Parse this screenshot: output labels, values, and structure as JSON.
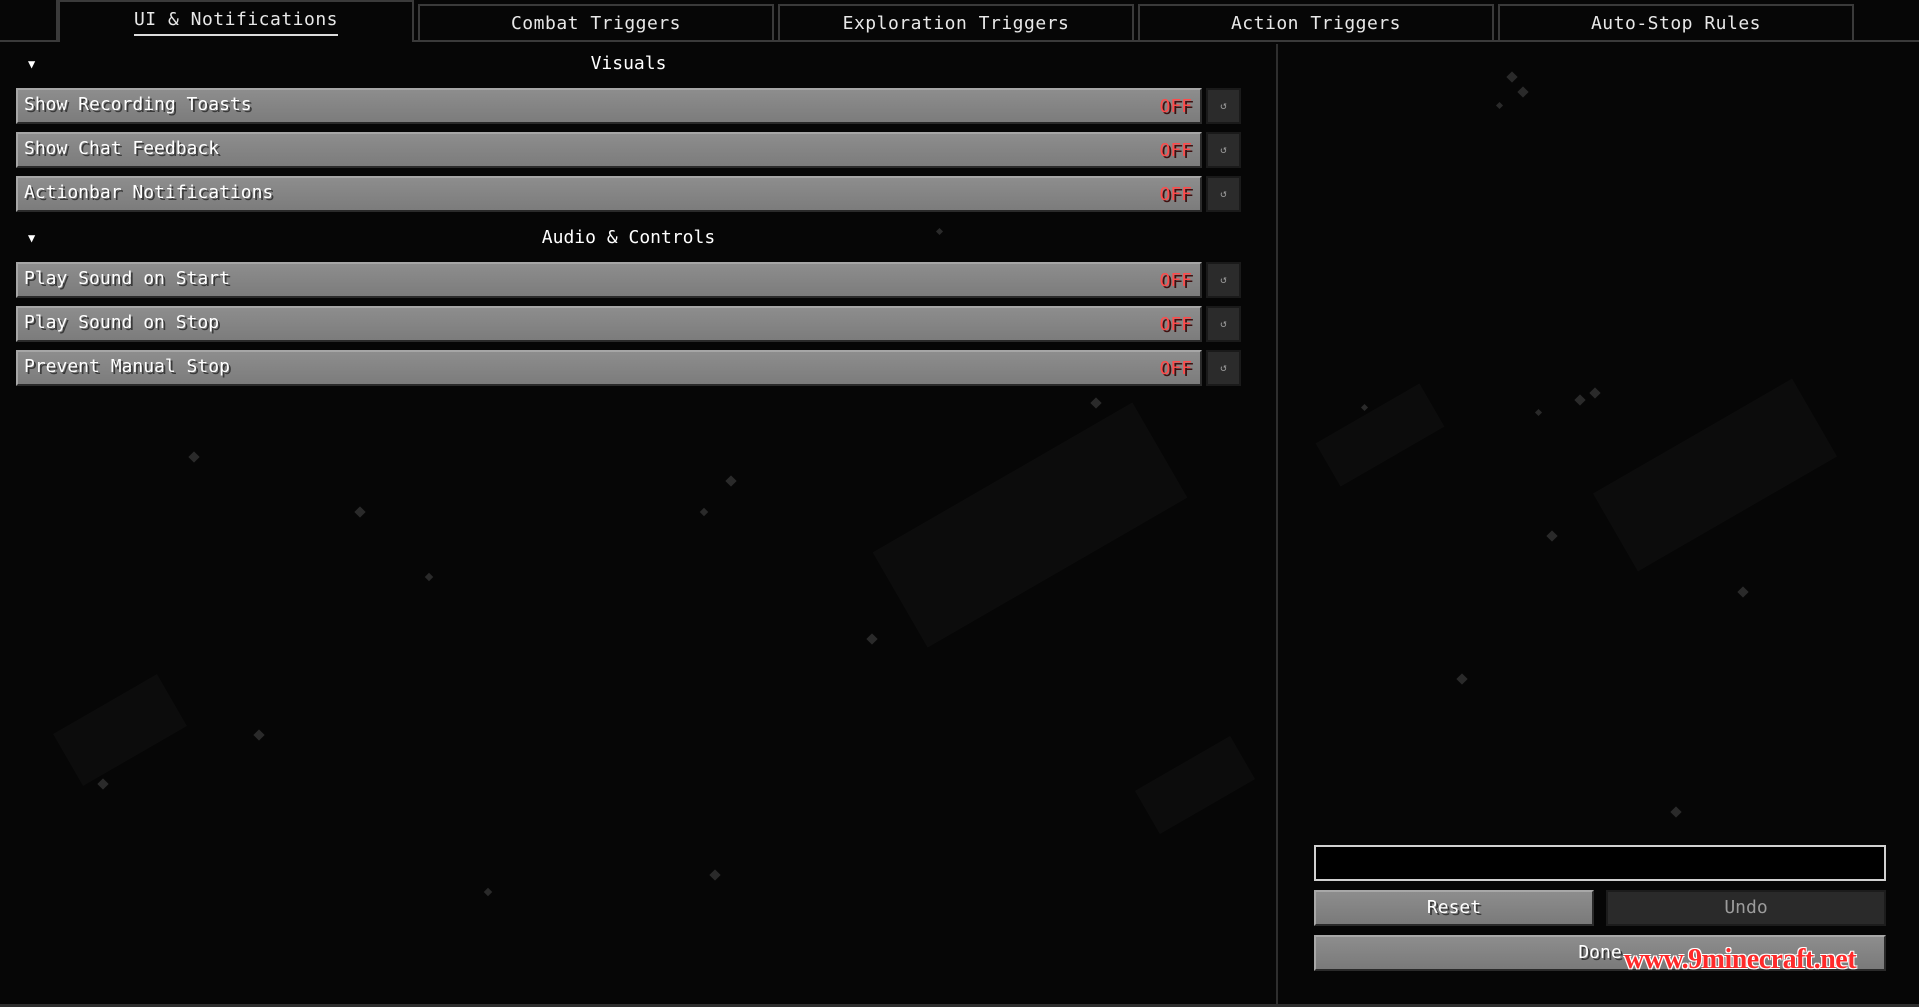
{
  "tabs": [
    {
      "label": "UI & Notifications",
      "active": true
    },
    {
      "label": "Combat Triggers",
      "active": false
    },
    {
      "label": "Exploration Triggers",
      "active": false
    },
    {
      "label": "Action Triggers",
      "active": false
    },
    {
      "label": "Auto-Stop Rules",
      "active": false
    }
  ],
  "sections": [
    {
      "title": "Visuals",
      "caret": "▼",
      "items": [
        {
          "label": "Show Recording Toasts",
          "value": "OFF",
          "reset": "↺"
        },
        {
          "label": "Show Chat Feedback",
          "value": "OFF",
          "reset": "↺"
        },
        {
          "label": "Actionbar Notifications",
          "value": "OFF",
          "reset": "↺"
        }
      ]
    },
    {
      "title": "Audio & Controls",
      "caret": "▼",
      "items": [
        {
          "label": "Play Sound on Start",
          "value": "OFF",
          "reset": "↺"
        },
        {
          "label": "Play Sound on Stop",
          "value": "OFF",
          "reset": "↺"
        },
        {
          "label": "Prevent Manual Stop",
          "value": "OFF",
          "reset": "↺"
        }
      ]
    }
  ],
  "side": {
    "search_value": "",
    "reset_label": "Reset",
    "undo_label": "Undo",
    "done_label": "Done"
  },
  "watermark": "www.9minecraft.net",
  "colors": {
    "off_value": "#ff4a4a",
    "button_face": "#858585",
    "button_disabled": "#2a2a2a",
    "background": "#060606"
  }
}
